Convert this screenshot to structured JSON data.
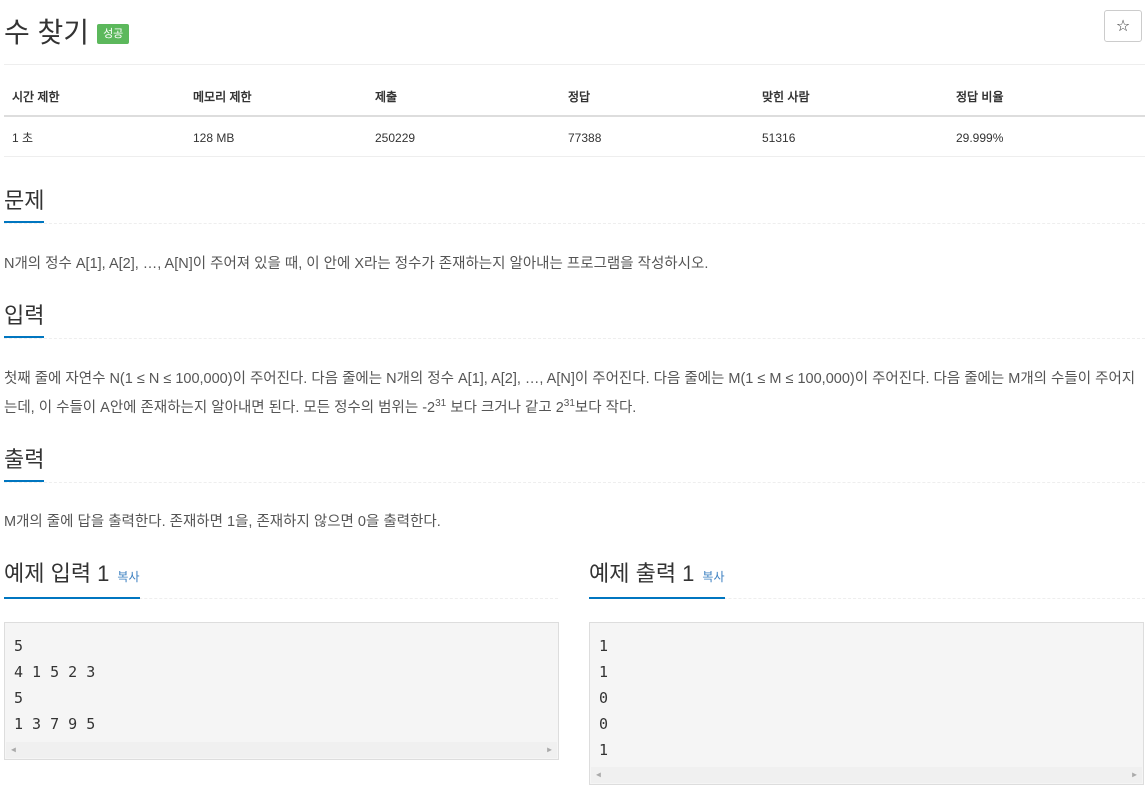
{
  "problem": {
    "title": "수 찾기",
    "status_badge": "성공",
    "star": "☆"
  },
  "stats": {
    "headers": [
      "시간 제한",
      "메모리 제한",
      "제출",
      "정답",
      "맞힌 사람",
      "정답 비율"
    ],
    "values": [
      "1 초",
      "128 MB",
      "250229",
      "77388",
      "51316",
      "29.999%"
    ]
  },
  "sections": {
    "description": {
      "heading": "문제",
      "text": "N개의 정수 A[1], A[2], …, A[N]이 주어져 있을 때, 이 안에 X라는 정수가 존재하는지 알아내는 프로그램을 작성하시오."
    },
    "input": {
      "heading": "입력",
      "text_1": "첫째 줄에 자연수 N(1 ≤ N ≤ 100,000)이 주어진다. 다음 줄에는 N개의 정수 A[1], A[2], …, A[N]이 주어진다. 다음 줄에는 M(1 ≤ M ≤ 100,000)이 주어진다. 다음 줄에는 M개의 수들이 주어지는데, 이 수들이 A안에 존재하는지 알아내면 된다. 모든 정수의 범위는 -2",
      "exp_1": "31",
      "text_2": " 보다 크거나 같고 2",
      "exp_2": "31",
      "text_3": "보다 작다."
    },
    "output": {
      "heading": "출력",
      "text": "M개의 줄에 답을 출력한다. 존재하면 1을, 존재하지 않으면 0을 출력한다."
    }
  },
  "samples": {
    "input": {
      "heading": "예제 입력 1",
      "copy_label": "복사",
      "content": "5\n4 1 5 2 3\n5\n1 3 7 9 5"
    },
    "output": {
      "heading": "예제 출력 1",
      "copy_label": "복사",
      "content": "1\n1\n0\n0\n1"
    },
    "scroll_left": "◀",
    "scroll_right": "▶"
  }
}
